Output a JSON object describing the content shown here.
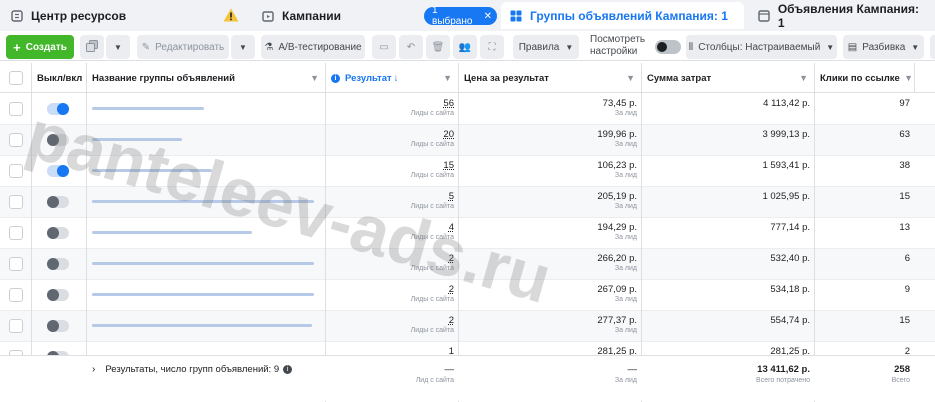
{
  "tabs": [
    {
      "label": "Центр ресурсов",
      "icon": "resource-center-icon"
    },
    {
      "label": "Кампании",
      "icon": "campaign-folder-icon",
      "chip": "1 выбрано"
    },
    {
      "label": "Группы объявлений Кампания: 1",
      "icon": "adsets-grid-icon",
      "active": true
    },
    {
      "label": "Объявления Кампания: 1",
      "icon": "ad-icon"
    }
  ],
  "toolbar": {
    "create": "Создать",
    "edit": "Редактировать",
    "ab_test": "A/B-тестирование",
    "rules": "Правила",
    "view_settings": "Посмотреть настройки",
    "columns": "Столбцы: Настраиваемый",
    "breakdown": "Разбивка"
  },
  "columns": {
    "toggle": "Выкл/вкл",
    "name": "Название группы объявлений",
    "result": "Результат",
    "cost_per_result": "Цена за результат",
    "amount_spent": "Сумма затрат",
    "link_clicks": "Клики по ссылке"
  },
  "rows": [
    {
      "on": true,
      "result": "56",
      "result_sub": "Лиды с сайта",
      "cpr": "73,45 р.",
      "cpr_sub": "За лид",
      "spent": "4 113,42 р.",
      "clicks": "97"
    },
    {
      "on": false,
      "result": "20",
      "result_sub": "Лиды с сайта",
      "cpr": "199,96 р.",
      "cpr_sub": "За лид",
      "spent": "3 999,13 р.",
      "clicks": "63"
    },
    {
      "on": true,
      "result": "15",
      "result_sub": "Лиды с сайта",
      "cpr": "106,23 р.",
      "cpr_sub": "За лид",
      "spent": "1 593,41 р.",
      "clicks": "38"
    },
    {
      "on": false,
      "result": "5",
      "result_sub": "Лиды с сайта",
      "cpr": "205,19 р.",
      "cpr_sub": "За лид",
      "spent": "1 025,95 р.",
      "clicks": "15"
    },
    {
      "on": false,
      "result": "4",
      "result_sub": "Лиды с сайта",
      "cpr": "194,29 р.",
      "cpr_sub": "За лид",
      "spent": "777,14 р.",
      "clicks": "13"
    },
    {
      "on": false,
      "result": "2",
      "result_sub": "Лиды с сайта",
      "cpr": "266,20 р.",
      "cpr_sub": "За лид",
      "spent": "532,40 р.",
      "clicks": "6"
    },
    {
      "on": false,
      "result": "2",
      "result_sub": "Лиды с сайта",
      "cpr": "267,09 р.",
      "cpr_sub": "За лид",
      "spent": "534,18 р.",
      "clicks": "9"
    },
    {
      "on": false,
      "result": "2",
      "result_sub": "Лиды с сайта",
      "cpr": "277,37 р.",
      "cpr_sub": "За лид",
      "spent": "554,74 р.",
      "clicks": "15"
    },
    {
      "on": false,
      "result": "1",
      "result_sub": "",
      "cpr": "281,25 р.",
      "cpr_sub": "",
      "spent": "281,25 р.",
      "clicks": "2"
    }
  ],
  "totals": {
    "label": "Результаты, число групп объявлений: 9",
    "result": "—",
    "result_sub": "Лид с сайта",
    "cpr": "—",
    "cpr_sub": "За лид",
    "spent": "13 411,62 р.",
    "spent_sub": "Всего потрачено",
    "clicks": "258",
    "clicks_sub": "Всего"
  },
  "watermark": "panteleev-ads.ru",
  "colors": {
    "accent": "#1877f2",
    "create": "#42b72a",
    "warning": "#f5c33b"
  }
}
